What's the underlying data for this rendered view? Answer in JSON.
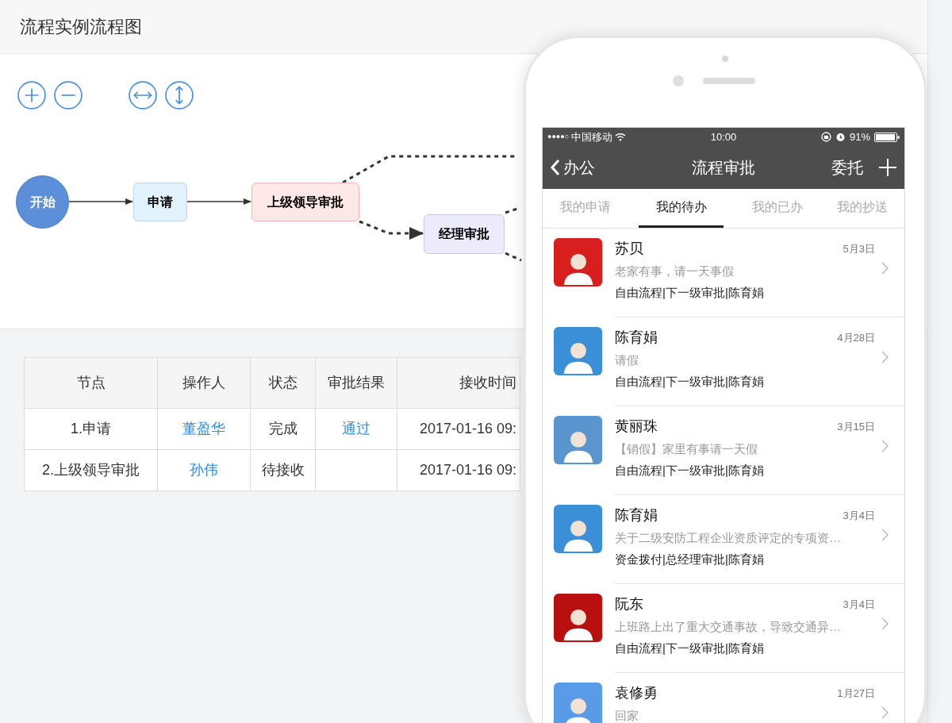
{
  "page": {
    "title": "流程实例流程图"
  },
  "toolbar": [
    {
      "kind": "zoom_in"
    },
    {
      "kind": "zoom_out"
    },
    {
      "kind": "fit_width"
    },
    {
      "kind": "fit_height"
    }
  ],
  "flowchart": {
    "nodes": [
      {
        "kind": "start",
        "label": "开始"
      },
      {
        "kind": "apply",
        "label": "申请"
      },
      {
        "kind": "leader",
        "label": "上级领导审批"
      },
      {
        "kind": "manager",
        "label": "经理审批"
      }
    ]
  },
  "table": {
    "columns": [
      "节点",
      "操作人",
      "状态",
      "审批结果",
      "接收时间"
    ],
    "rows": [
      {
        "cells": [
          {
            "kind": "text",
            "text": "1.申请"
          },
          {
            "kind": "link",
            "text": "董盈华"
          },
          {
            "kind": "text",
            "text": "完成"
          },
          {
            "kind": "link",
            "text": "通过"
          },
          {
            "kind": "text",
            "text": "2017-01-16 09:"
          }
        ]
      },
      {
        "cells": [
          {
            "kind": "text",
            "text": "2.上级领导审批"
          },
          {
            "kind": "link",
            "text": "孙伟"
          },
          {
            "kind": "text",
            "text": "待接收"
          },
          {
            "kind": "empty"
          },
          {
            "kind": "text",
            "text": "2017-01-16 09:"
          }
        ]
      }
    ]
  },
  "phone": {
    "status_bar": {
      "signal": "●●●●○",
      "carrier": "中国移动",
      "time": "10:00",
      "battery": "91%"
    },
    "nav": {
      "back": "办公",
      "title": "流程审批",
      "action": "委托"
    },
    "tabs": [
      {
        "label": "我的申请",
        "selected": false
      },
      {
        "label": "我的待办",
        "selected": true
      },
      {
        "label": "我的已办",
        "selected": false
      },
      {
        "label": "我的抄送",
        "selected": false
      }
    ],
    "items": [
      {
        "name": "苏贝",
        "date": "5月3日",
        "summary": "老家有事，请一天事假",
        "flow": "自由流程|下一级审批|陈育娟",
        "color": "#d91e1e"
      },
      {
        "name": "陈育娟",
        "date": "4月28日",
        "summary": "请假",
        "flow": "自由流程|下一级审批|陈育娟",
        "color": "#3b8fd6"
      },
      {
        "name": "黄丽珠",
        "date": "3月15日",
        "summary": "【销假】家里有事请一天假",
        "flow": "自由流程|下一级审批|陈育娟",
        "color": "#5b95cf"
      },
      {
        "name": "陈育娟",
        "date": "3月4日",
        "summary": "关于二级安防工程企业资质评定的专项资…",
        "flow": "资金拨付|总经理审批|陈育娟",
        "color": "#3b8fd6"
      },
      {
        "name": "阮东",
        "date": "3月4日",
        "summary": "上班路上出了重大交通事故，导致交通异…",
        "flow": "自由流程|下一级审批|陈育娟",
        "color": "#b80f0f"
      },
      {
        "name": "袁修勇",
        "date": "1月27日",
        "summary": "回家",
        "color": "#5a9be8"
      }
    ]
  }
}
